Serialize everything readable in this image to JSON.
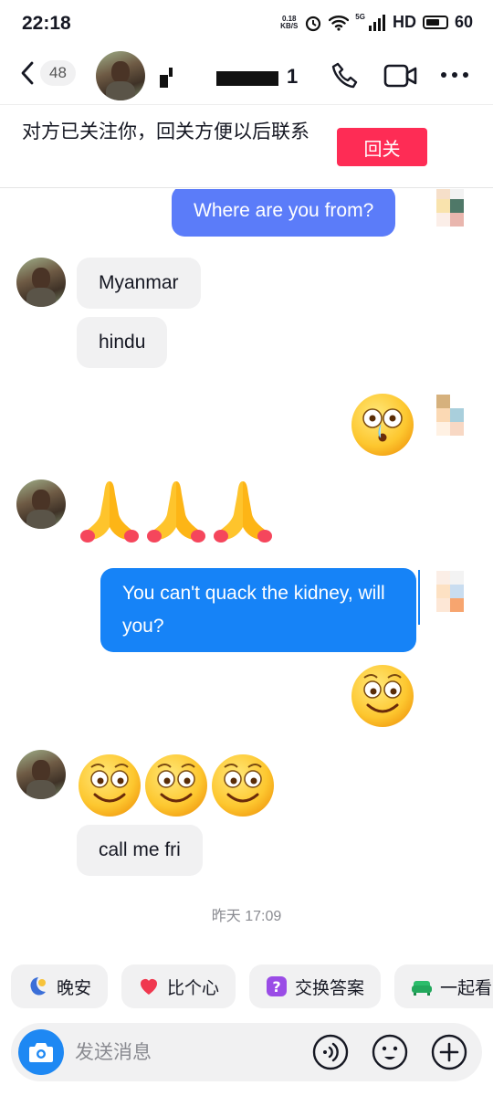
{
  "status_bar": {
    "time": "22:18",
    "net_speed_value": "0.18",
    "net_speed_unit": "KB/S",
    "network": "5G",
    "hd": "HD",
    "battery": "60"
  },
  "header": {
    "back_badge": "48",
    "name_partial": "1"
  },
  "follow_banner": {
    "text": "对方已关注你，回关方便以后联系",
    "button": "回关"
  },
  "messages": {
    "m1": "Where are you from?",
    "m2": "Myanmar",
    "m3": "hindu",
    "m5": "You can't quack the kidney, will you?",
    "m8": "call me fri"
  },
  "timestamp": "昨天 17:09",
  "chips": {
    "c1": "晚安",
    "c2": "比个心",
    "c3": "交换答案",
    "c4": "一起看"
  },
  "input": {
    "placeholder": "发送消息"
  },
  "colors": {
    "accent_red": "#fe2c55",
    "sent_bubble": "#5b7cf9",
    "sent_bubble_alt": "#1683f7",
    "recv_bubble": "#f1f1f2",
    "camera_blue": "#1e88f3"
  }
}
